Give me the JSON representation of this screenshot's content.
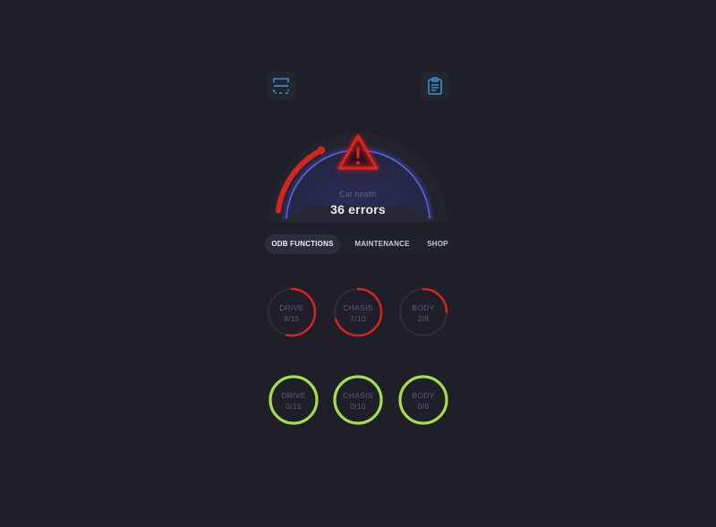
{
  "header": {
    "scan_icon": "scan-frame-icon",
    "report_icon": "clipboard-icon"
  },
  "health": {
    "label": "Car health",
    "value": "36 errors",
    "warning_icon": "warning-triangle-icon",
    "level": 0.45
  },
  "tabs": [
    {
      "label": "ODB FUNCTIONS",
      "active": true
    },
    {
      "label": "MAINTENANCE",
      "active": false
    },
    {
      "label": "SHOP",
      "active": false
    }
  ],
  "error_rings": [
    {
      "name": "DRIVE",
      "count": "8/15",
      "progress": 0.5333
    },
    {
      "name": "CHASIS",
      "count": "7/10",
      "progress": 0.7
    },
    {
      "name": "BODY",
      "count": "2/8",
      "progress": 0.25
    }
  ],
  "ok_rings": [
    {
      "name": "DRIVE",
      "count": "0/15",
      "progress": 1
    },
    {
      "name": "CHASIS",
      "count": "0/10",
      "progress": 1
    },
    {
      "name": "BODY",
      "count": "0/8",
      "progress": 1
    }
  ],
  "colors": {
    "error": "#d8241e",
    "ok": "#a6dd4c",
    "track": "#2a2c36",
    "accent": "#3d8fd6",
    "glow": "#4b4fd8"
  }
}
